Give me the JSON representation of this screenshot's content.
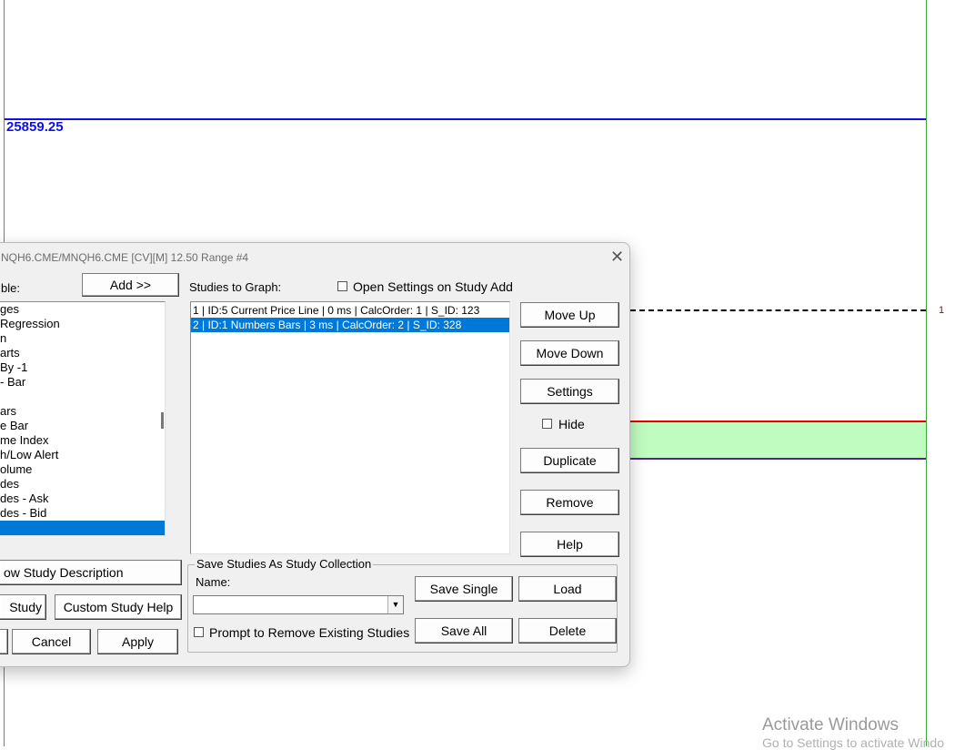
{
  "chart": {
    "price_label": "25859.25",
    "marker_label": "1",
    "colors": {
      "price_line": "#1010e8",
      "red_line": "#e80000",
      "purple_line": "#5a1fa0",
      "zone_fill": "#c0fcc0",
      "right_border": "#3aa63a"
    }
  },
  "watermark": {
    "line1": "Activate Windows",
    "line2": "Go to Settings to activate Windo"
  },
  "dialog": {
    "title": "NQH6.CME/MNQH6.CME [CV][M]  12.50 Range #4",
    "close_glyph": "✕",
    "left_label": "ble:",
    "add_button": "Add >>",
    "available_studies": [
      "ges",
      " Regression",
      "n",
      "arts",
      "By -1",
      " - Bar",
      "",
      "ars",
      "e Bar",
      "me Index",
      "h/Low Alert",
      "olume",
      "des",
      "des - Ask",
      "des - Bid",
      ""
    ],
    "selected_available_index": 15,
    "studies_to_graph_label": "Studies to Graph:",
    "open_settings_label": "Open Settings on Study Add",
    "studies": [
      "1 | ID:5  Current Price Line | 0 ms | CalcOrder: 1 | S_ID: 123",
      "2 | ID:1  Numbers Bars | 3 ms | CalcOrder: 2 | S_ID: 328"
    ],
    "selected_study_index": 1,
    "buttons": {
      "move_up": "Move Up",
      "move_down": "Move Down",
      "settings": "Settings",
      "hide": "Hide",
      "duplicate": "Duplicate",
      "remove": "Remove",
      "help": "Help",
      "show_desc": "ow Study Description",
      "study": "Study",
      "custom_help": "Custom Study Help",
      "cancel": "Cancel",
      "apply": "Apply",
      "save_single": "Save Single",
      "load": "Load",
      "save_all": "Save All",
      "delete": "Delete"
    },
    "collection": {
      "group_label": "Save Studies As Study Collection",
      "name_label": "Name:",
      "name_value": "",
      "prompt_remove_label": "Prompt to Remove Existing Studies",
      "dropdown_glyph": "▼"
    }
  }
}
